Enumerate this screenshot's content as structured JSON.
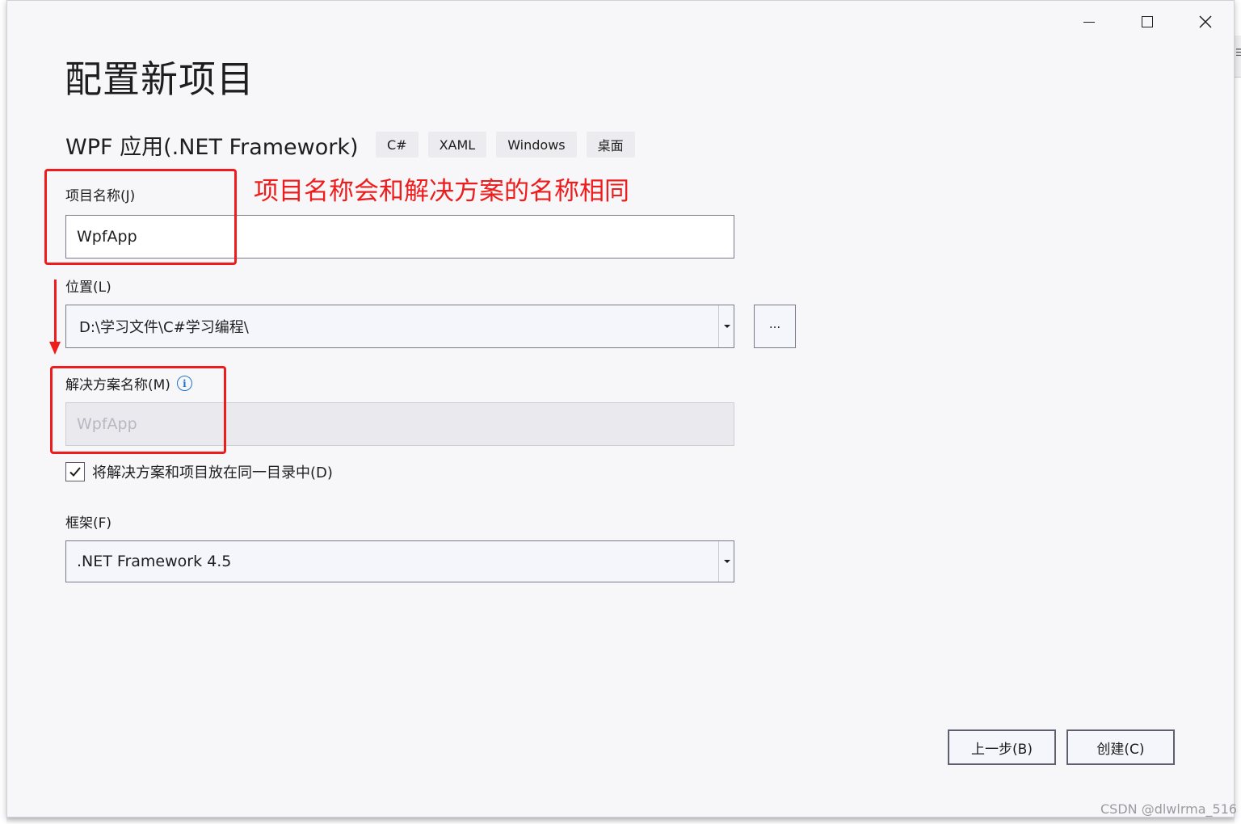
{
  "window": {
    "page_title": "配置新项目",
    "template_name": "WPF 应用(.NET Framework)",
    "tags": [
      "C#",
      "XAML",
      "Windows",
      "桌面"
    ],
    "edge_glyph": "☰"
  },
  "form": {
    "project_name": {
      "label": "项目名称(J)",
      "value": "WpfApp"
    },
    "location": {
      "label": "位置(L)",
      "value": "D:\\学习文件\\C#学习编程\\",
      "browse_label": "..."
    },
    "solution_name": {
      "label": "解决方案名称(M)",
      "info_icon": "i",
      "value": "WpfApp"
    },
    "same_directory": {
      "label": "将解决方案和项目放在同一目录中(D)",
      "checked": true
    },
    "framework": {
      "label": "框架(F)",
      "value": ".NET Framework 4.5"
    }
  },
  "buttons": {
    "back": "上一步(B)",
    "create": "创建(C)"
  },
  "annotation": {
    "text": "项目名称会和解决方案的名称相同",
    "color": "#ee1c1c"
  },
  "watermark": "CSDN @dlwlrma_516",
  "icons": {
    "minimize": "minimize-icon",
    "maximize": "maximize-icon",
    "close": "close-icon",
    "dropdown": "chevron-down-icon",
    "check": "checkmark-icon",
    "info": "info-icon"
  },
  "colors": {
    "accent_info": "#1f74c9",
    "annotation_red": "#ee1c1c"
  }
}
